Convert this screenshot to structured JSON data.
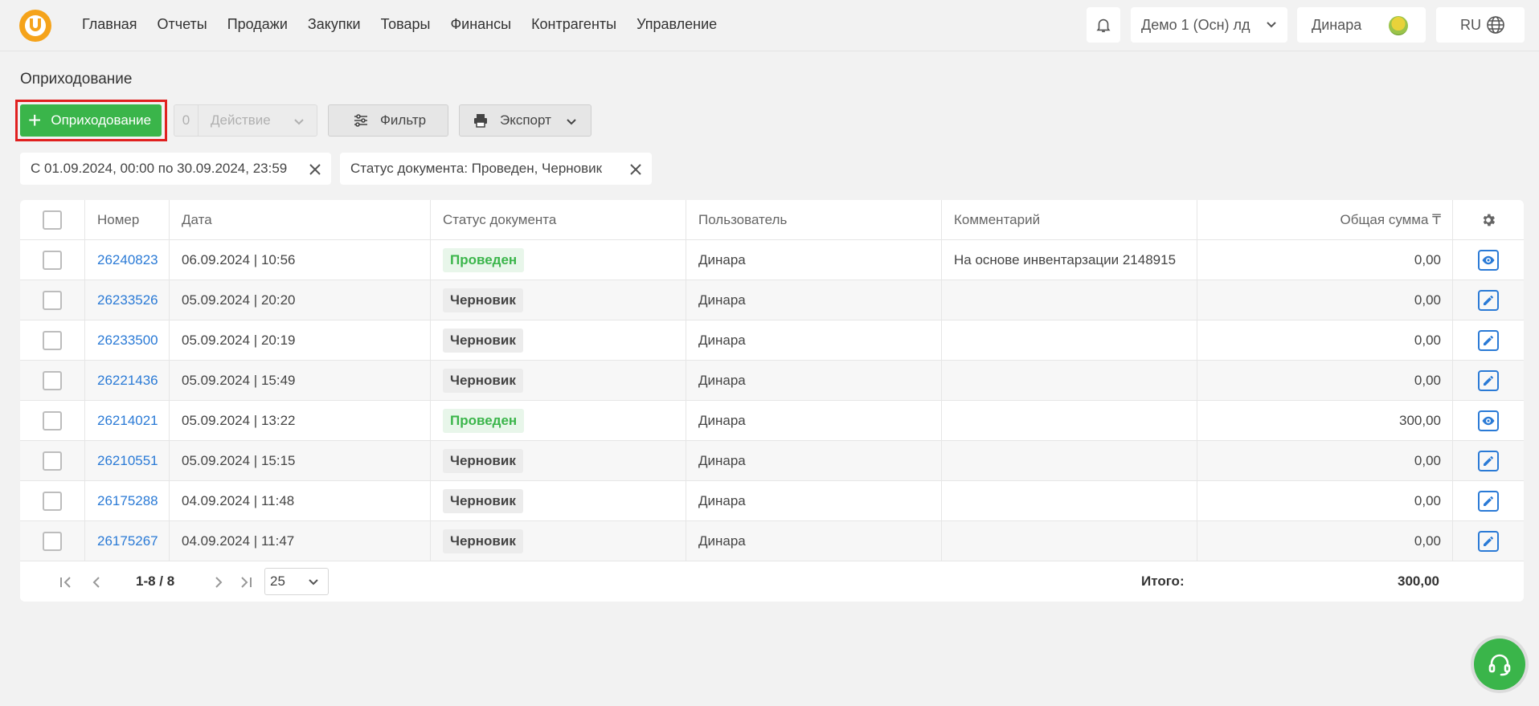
{
  "nav": [
    "Главная",
    "Отчеты",
    "Продажи",
    "Закупки",
    "Товары",
    "Финансы",
    "Контрагенты",
    "Управление"
  ],
  "header": {
    "company": "Демо 1 (Осн) лд",
    "user": "Динара",
    "lang": "RU"
  },
  "page_title": "Оприходование",
  "toolbar": {
    "create_label": "Оприходование",
    "action_count": "0",
    "action_label": "Действие",
    "filter_label": "Фильтр",
    "export_label": "Экспорт"
  },
  "chips": [
    "С 01.09.2024, 00:00 по 30.09.2024, 23:59",
    "Статус документа: Проведен, Черновик"
  ],
  "table": {
    "headers": [
      "Номер",
      "Дата",
      "Статус документа",
      "Пользователь",
      "Комментарий",
      "Общая сумма ₸"
    ],
    "rows": [
      {
        "number": "26240823",
        "date": "06.09.2024 | 10:56",
        "status": "Проведен",
        "user": "Динара",
        "comment": "На основе инвентарзации 2148915",
        "sum": "0,00",
        "action": "view"
      },
      {
        "number": "26233526",
        "date": "05.09.2024 | 20:20",
        "status": "Черновик",
        "user": "Динара",
        "comment": "",
        "sum": "0,00",
        "action": "edit"
      },
      {
        "number": "26233500",
        "date": "05.09.2024 | 20:19",
        "status": "Черновик",
        "user": "Динара",
        "comment": "",
        "sum": "0,00",
        "action": "edit"
      },
      {
        "number": "26221436",
        "date": "05.09.2024 | 15:49",
        "status": "Черновик",
        "user": "Динара",
        "comment": "",
        "sum": "0,00",
        "action": "edit"
      },
      {
        "number": "26214021",
        "date": "05.09.2024 | 13:22",
        "status": "Проведен",
        "user": "Динара",
        "comment": "",
        "sum": "300,00",
        "action": "view"
      },
      {
        "number": "26210551",
        "date": "05.09.2024 | 15:15",
        "status": "Черновик",
        "user": "Динара",
        "comment": "",
        "sum": "0,00",
        "action": "edit"
      },
      {
        "number": "26175288",
        "date": "04.09.2024 | 11:48",
        "status": "Черновик",
        "user": "Динара",
        "comment": "",
        "sum": "0,00",
        "action": "edit"
      },
      {
        "number": "26175267",
        "date": "04.09.2024 | 11:47",
        "status": "Черновик",
        "user": "Динара",
        "comment": "",
        "sum": "0,00",
        "action": "edit"
      }
    ]
  },
  "footer": {
    "pager": "1-8 / 8",
    "per_page": "25",
    "total_label": "Итого:",
    "total_value": "300,00"
  },
  "colors": {
    "primary_green": "#3ab54a",
    "link_blue": "#2a7ad6",
    "highlight_red": "#e0201f",
    "logo_orange": "#f5a31a"
  }
}
